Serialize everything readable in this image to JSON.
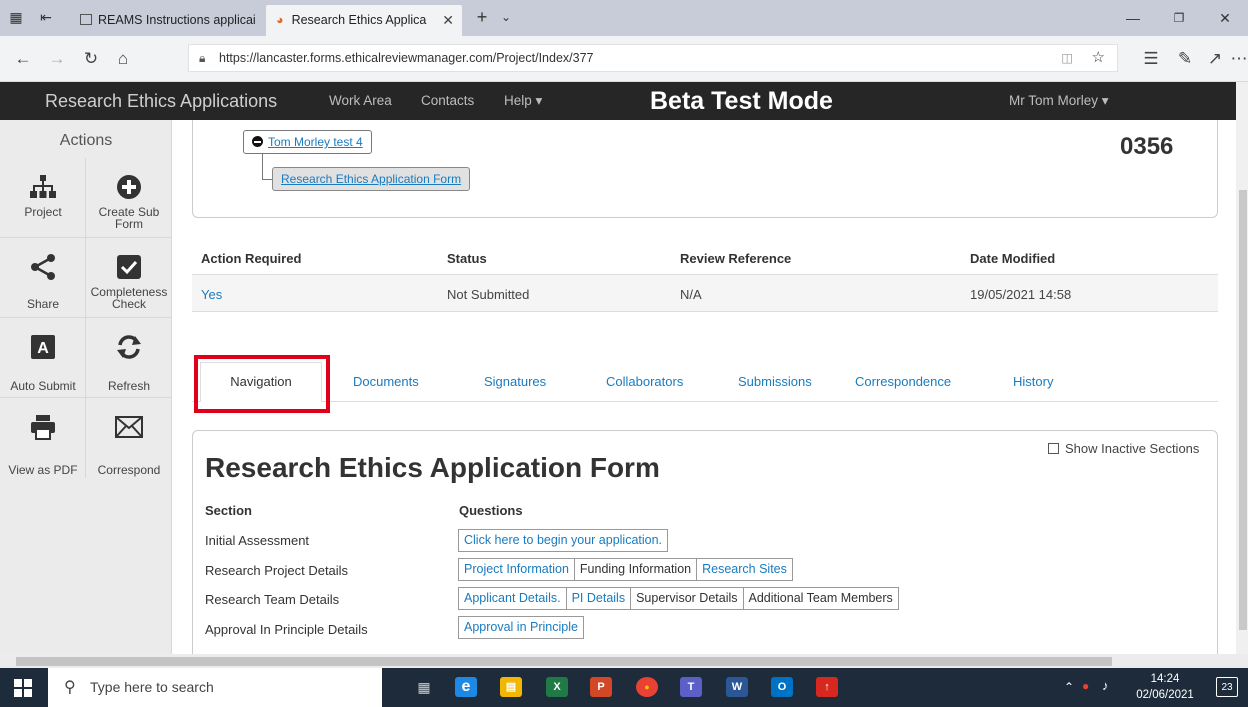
{
  "browser": {
    "tabs": [
      {
        "label": "REAMS Instructions applicai",
        "active": false
      },
      {
        "label": "Research Ethics Applica",
        "active": true
      }
    ],
    "new_tab_symbol": "+",
    "url": "https://lancaster.forms.ethicalreviewmanager.com/Project/Index/377"
  },
  "app_nav": {
    "brand": "Research Ethics Applications",
    "links": [
      "Work Area",
      "Contacts",
      "Help ▾"
    ],
    "banner": "Beta Test Mode",
    "user": "Mr Tom Morley ▾"
  },
  "sidebar": {
    "title": "Actions",
    "actions": [
      {
        "label": "Project",
        "icon": "sitemap-icon"
      },
      {
        "label": "Create Sub Form",
        "icon": "plus-circle-icon"
      },
      {
        "label": "Share",
        "icon": "share-icon"
      },
      {
        "label": "Completeness Check",
        "icon": "checkbox-icon"
      },
      {
        "label": "Auto Submit",
        "icon": "auto-submit-icon"
      },
      {
        "label": "Refresh",
        "icon": "refresh-icon"
      },
      {
        "label": "View as PDF",
        "icon": "printer-icon"
      },
      {
        "label": "Correspond",
        "icon": "envelope-icon"
      }
    ]
  },
  "project": {
    "root_node": "Tom Morley test 4",
    "child_node": "Research Ethics Application Form",
    "number": "0356"
  },
  "summary": {
    "headers": [
      "Action Required",
      "Status",
      "Review Reference",
      "Date Modified"
    ],
    "values": [
      "Yes",
      "Not Submitted",
      "N/A",
      "19/05/2021 14:58"
    ]
  },
  "tabs": [
    "Navigation",
    "Documents",
    "Signatures",
    "Collaborators",
    "Submissions",
    "Correspondence",
    "History"
  ],
  "form": {
    "title": "Research Ethics Application Form",
    "show_inactive_label": "Show Inactive Sections",
    "col_section": "Section",
    "col_questions": "Questions",
    "rows": [
      {
        "section": "Initial Assessment",
        "questions": [
          {
            "label": "Click here to begin your application.",
            "link": true
          }
        ]
      },
      {
        "section": "Research Project Details",
        "questions": [
          {
            "label": "Project Information",
            "link": true
          },
          {
            "label": "Funding Information",
            "link": false
          },
          {
            "label": "Research Sites",
            "link": true
          }
        ]
      },
      {
        "section": "Research Team Details",
        "questions": [
          {
            "label": "Applicant Details.",
            "link": true
          },
          {
            "label": "PI Details",
            "link": true
          },
          {
            "label": "Supervisor Details",
            "link": false
          },
          {
            "label": "Additional Team Members",
            "link": false
          }
        ]
      },
      {
        "section": "Approval In Principle Details",
        "questions": [
          {
            "label": "Approval in Principle",
            "link": true
          }
        ]
      }
    ]
  },
  "taskbar": {
    "search_placeholder": "Type here to search",
    "time": "14:24",
    "date": "02/06/2021",
    "notification_count": "23",
    "apps": [
      {
        "icon": "edge-icon",
        "glyph": "e",
        "color": "#1e88e5"
      },
      {
        "icon": "file-explorer-icon",
        "glyph": "▤",
        "color": "#f2b705"
      },
      {
        "icon": "excel-icon",
        "glyph": "X",
        "color": "#1f7a45"
      },
      {
        "icon": "powerpoint-icon",
        "glyph": "P",
        "color": "#d24726"
      },
      {
        "icon": "chrome-icon",
        "glyph": "●",
        "color": "#e94235"
      },
      {
        "icon": "teams-icon",
        "glyph": "T",
        "color": "#5b5fc7"
      },
      {
        "icon": "word-icon",
        "glyph": "W",
        "color": "#2b5797"
      },
      {
        "icon": "outlook-icon",
        "glyph": "O",
        "color": "#0072c6"
      },
      {
        "icon": "acrobat-icon",
        "glyph": "↑",
        "color": "#d7281f"
      }
    ]
  }
}
